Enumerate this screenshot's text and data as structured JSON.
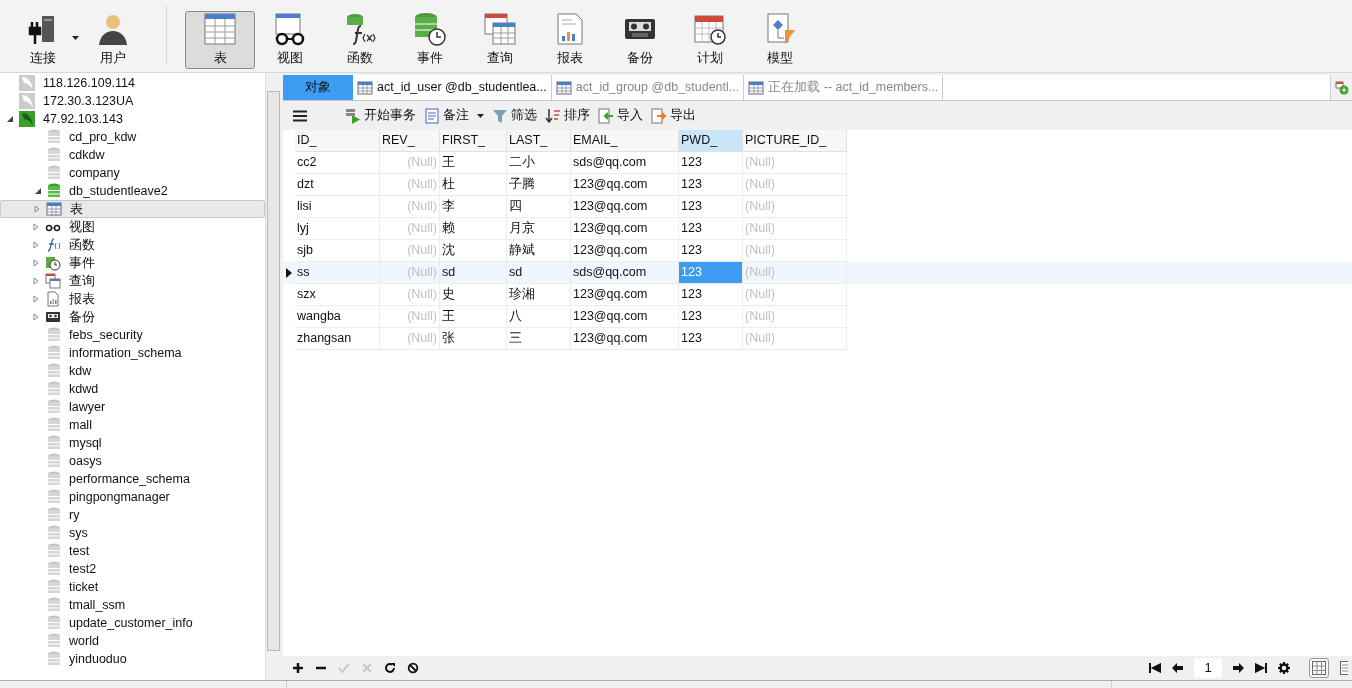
{
  "toolbar": {
    "buttons": [
      {
        "kind": "connect",
        "label": "连接",
        "selected": false,
        "dropdown": true
      },
      {
        "kind": "user",
        "label": "用户",
        "selected": false,
        "dropdown": false
      },
      {
        "kind": "table",
        "label": "表",
        "selected": true,
        "dropdown": false
      },
      {
        "kind": "view",
        "label": "视图",
        "selected": false,
        "dropdown": false
      },
      {
        "kind": "function",
        "label": "函数",
        "selected": false,
        "dropdown": false
      },
      {
        "kind": "event",
        "label": "事件",
        "selected": false,
        "dropdown": false
      },
      {
        "kind": "query",
        "label": "查询",
        "selected": false,
        "dropdown": false
      },
      {
        "kind": "report",
        "label": "报表",
        "selected": false,
        "dropdown": false
      },
      {
        "kind": "backup",
        "label": "备份",
        "selected": false,
        "dropdown": false
      },
      {
        "kind": "schedule",
        "label": "计划",
        "selected": false,
        "dropdown": false
      },
      {
        "kind": "model",
        "label": "模型",
        "selected": false,
        "dropdown": false
      }
    ]
  },
  "sidebar": {
    "tree": [
      {
        "kind": "connection",
        "label": "118.126.109.114",
        "open": false
      },
      {
        "kind": "connection",
        "label": "172.30.3.123UA",
        "open": false
      },
      {
        "kind": "connection",
        "label": "47.92.103.143",
        "open": true,
        "expanded": true,
        "children": [
          {
            "kind": "database",
            "label": "cd_pro_kdw",
            "open": false
          },
          {
            "kind": "database",
            "label": "cdkdw",
            "open": false
          },
          {
            "kind": "database",
            "label": "company",
            "open": false
          },
          {
            "kind": "database",
            "label": "db_studentleave2",
            "open": true,
            "expanded": true,
            "children": [
              {
                "kind": "table",
                "label": "表",
                "selected": true
              },
              {
                "kind": "view",
                "label": "视图",
                "selected": false
              },
              {
                "kind": "function",
                "label": "函数",
                "selected": false
              },
              {
                "kind": "event",
                "label": "事件",
                "selected": false
              },
              {
                "kind": "query",
                "label": "查询",
                "selected": false
              },
              {
                "kind": "report",
                "label": "报表",
                "selected": false
              },
              {
                "kind": "backup",
                "label": "备份",
                "selected": false
              }
            ]
          },
          {
            "kind": "database",
            "label": "febs_security",
            "open": false
          },
          {
            "kind": "database",
            "label": "information_schema",
            "open": false
          },
          {
            "kind": "database",
            "label": "kdw",
            "open": false
          },
          {
            "kind": "database",
            "label": "kdwd",
            "open": false
          },
          {
            "kind": "database",
            "label": "lawyer",
            "open": false
          },
          {
            "kind": "database",
            "label": "mall",
            "open": false
          },
          {
            "kind": "database",
            "label": "mysql",
            "open": false
          },
          {
            "kind": "database",
            "label": "oasys",
            "open": false
          },
          {
            "kind": "database",
            "label": "performance_schema",
            "open": false
          },
          {
            "kind": "database",
            "label": "pingpongmanager",
            "open": false
          },
          {
            "kind": "database",
            "label": "ry",
            "open": false
          },
          {
            "kind": "database",
            "label": "sys",
            "open": false
          },
          {
            "kind": "database",
            "label": "test",
            "open": false
          },
          {
            "kind": "database",
            "label": "test2",
            "open": false
          },
          {
            "kind": "database",
            "label": "ticket",
            "open": false
          },
          {
            "kind": "database",
            "label": "tmall_ssm",
            "open": false
          },
          {
            "kind": "database",
            "label": "update_customer_info",
            "open": false
          },
          {
            "kind": "database",
            "label": "world",
            "open": false
          },
          {
            "kind": "database",
            "label": "yinduoduo",
            "open": false
          }
        ]
      }
    ]
  },
  "tabs": [
    {
      "kind": "objects",
      "label": "对象",
      "selected": false
    },
    {
      "kind": "table",
      "label": "act_id_user @db_studentlea...",
      "selected": true
    },
    {
      "kind": "table",
      "label": "act_id_group @db_studentl...",
      "selected": false
    },
    {
      "kind": "table",
      "label": "正在加载 -- act_id_members...",
      "selected": false
    }
  ],
  "actions": [
    {
      "kind": "transaction",
      "label": "开始事务",
      "dropdown": false
    },
    {
      "kind": "note",
      "label": "备注",
      "dropdown": true
    },
    {
      "kind": "filter",
      "label": "筛选",
      "dropdown": false
    },
    {
      "kind": "sort",
      "label": "排序",
      "dropdown": false
    },
    {
      "kind": "import",
      "label": "导入",
      "dropdown": false
    },
    {
      "kind": "export",
      "label": "导出",
      "dropdown": false
    }
  ],
  "grid": {
    "columns": [
      {
        "label": "ID_",
        "selected": false
      },
      {
        "label": "REV_",
        "selected": false
      },
      {
        "label": "FIRST_",
        "selected": false
      },
      {
        "label": "LAST_",
        "selected": false
      },
      {
        "label": "EMAIL_",
        "selected": false
      },
      {
        "label": "PWD_",
        "selected": true
      },
      {
        "label": "PICTURE_ID_",
        "selected": false
      }
    ],
    "rows": [
      {
        "current": false,
        "cells": [
          {
            "text": "cc2",
            "null": false,
            "selected": false
          },
          {
            "text": "(Null)",
            "null": true,
            "selected": false
          },
          {
            "text": "王",
            "null": false,
            "selected": false
          },
          {
            "text": "二小",
            "null": false,
            "selected": false
          },
          {
            "text": "sds@qq.com",
            "null": false,
            "selected": false
          },
          {
            "text": "123",
            "null": false,
            "selected": false
          },
          {
            "text": "(Null)",
            "null": true,
            "selected": false
          }
        ]
      },
      {
        "current": false,
        "cells": [
          {
            "text": "dzt",
            "null": false,
            "selected": false
          },
          {
            "text": "(Null)",
            "null": true,
            "selected": false
          },
          {
            "text": "杜",
            "null": false,
            "selected": false
          },
          {
            "text": "子腾",
            "null": false,
            "selected": false
          },
          {
            "text": "123@qq.com",
            "null": false,
            "selected": false
          },
          {
            "text": "123",
            "null": false,
            "selected": false
          },
          {
            "text": "(Null)",
            "null": true,
            "selected": false
          }
        ]
      },
      {
        "current": false,
        "cells": [
          {
            "text": "lisi",
            "null": false,
            "selected": false
          },
          {
            "text": "(Null)",
            "null": true,
            "selected": false
          },
          {
            "text": "李",
            "null": false,
            "selected": false
          },
          {
            "text": "四",
            "null": false,
            "selected": false
          },
          {
            "text": "123@qq.com",
            "null": false,
            "selected": false
          },
          {
            "text": "123",
            "null": false,
            "selected": false
          },
          {
            "text": "(Null)",
            "null": true,
            "selected": false
          }
        ]
      },
      {
        "current": false,
        "cells": [
          {
            "text": "lyj",
            "null": false,
            "selected": false
          },
          {
            "text": "(Null)",
            "null": true,
            "selected": false
          },
          {
            "text": "赖",
            "null": false,
            "selected": false
          },
          {
            "text": "月京",
            "null": false,
            "selected": false
          },
          {
            "text": "123@qq.com",
            "null": false,
            "selected": false
          },
          {
            "text": "123",
            "null": false,
            "selected": false
          },
          {
            "text": "(Null)",
            "null": true,
            "selected": false
          }
        ]
      },
      {
        "current": false,
        "cells": [
          {
            "text": "sjb",
            "null": false,
            "selected": false
          },
          {
            "text": "(Null)",
            "null": true,
            "selected": false
          },
          {
            "text": "沈",
            "null": false,
            "selected": false
          },
          {
            "text": "静斌",
            "null": false,
            "selected": false
          },
          {
            "text": "123@qq.com",
            "null": false,
            "selected": false
          },
          {
            "text": "123",
            "null": false,
            "selected": false
          },
          {
            "text": "(Null)",
            "null": true,
            "selected": false
          }
        ]
      },
      {
        "current": true,
        "cells": [
          {
            "text": "ss",
            "null": false,
            "selected": false
          },
          {
            "text": "(Null)",
            "null": true,
            "selected": false
          },
          {
            "text": "sd",
            "null": false,
            "selected": false
          },
          {
            "text": "sd",
            "null": false,
            "selected": false
          },
          {
            "text": "sds@qq.com",
            "null": false,
            "selected": false
          },
          {
            "text": "123",
            "null": false,
            "selected": true
          },
          {
            "text": "(Null)",
            "null": true,
            "selected": false
          }
        ]
      },
      {
        "current": false,
        "cells": [
          {
            "text": "szx",
            "null": false,
            "selected": false
          },
          {
            "text": "(Null)",
            "null": true,
            "selected": false
          },
          {
            "text": "史",
            "null": false,
            "selected": false
          },
          {
            "text": "珍湘",
            "null": false,
            "selected": false
          },
          {
            "text": "123@qq.com",
            "null": false,
            "selected": false
          },
          {
            "text": "123",
            "null": false,
            "selected": false
          },
          {
            "text": "(Null)",
            "null": true,
            "selected": false
          }
        ]
      },
      {
        "current": false,
        "cells": [
          {
            "text": "wangba",
            "null": false,
            "selected": false
          },
          {
            "text": "(Null)",
            "null": true,
            "selected": false
          },
          {
            "text": "王",
            "null": false,
            "selected": false
          },
          {
            "text": "八",
            "null": false,
            "selected": false
          },
          {
            "text": "123@qq.com",
            "null": false,
            "selected": false
          },
          {
            "text": "123",
            "null": false,
            "selected": false
          },
          {
            "text": "(Null)",
            "null": true,
            "selected": false
          }
        ]
      },
      {
        "current": false,
        "cells": [
          {
            "text": "zhangsan",
            "null": false,
            "selected": false
          },
          {
            "text": "(Null)",
            "null": true,
            "selected": false
          },
          {
            "text": "张",
            "null": false,
            "selected": false
          },
          {
            "text": "三",
            "null": false,
            "selected": false
          },
          {
            "text": "123@qq.com",
            "null": false,
            "selected": false
          },
          {
            "text": "123",
            "null": false,
            "selected": false
          },
          {
            "text": "(Null)",
            "null": true,
            "selected": false
          }
        ]
      }
    ]
  },
  "bottom_bar": {
    "edit_buttons": [
      {
        "kind": "add",
        "disabled": false
      },
      {
        "kind": "delete",
        "disabled": false
      },
      {
        "kind": "apply",
        "disabled": true
      },
      {
        "kind": "cancel",
        "disabled": true
      },
      {
        "kind": "refresh",
        "disabled": false
      },
      {
        "kind": "stop",
        "disabled": false
      }
    ],
    "page": "1"
  }
}
